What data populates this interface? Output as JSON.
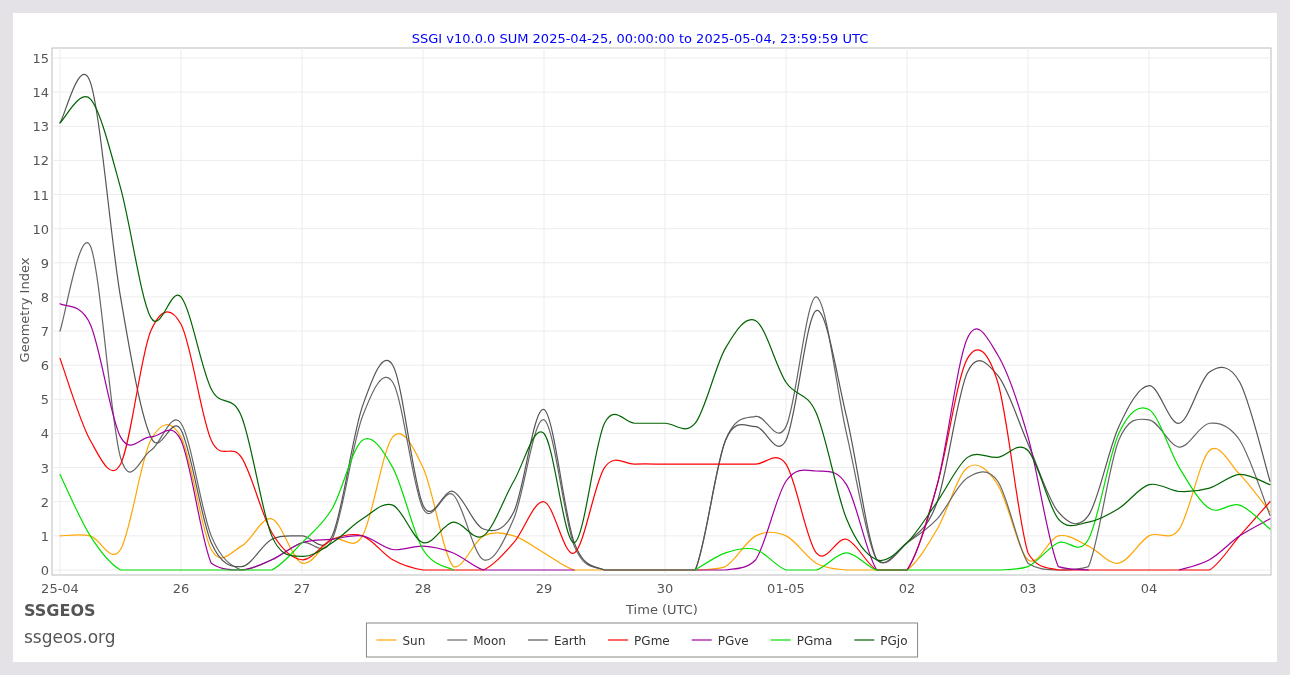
{
  "chart": {
    "brand": "SSGEOS",
    "site": "ssgeos.org",
    "chart_data": {
      "type": "line",
      "title": "SSGI v10.0.0 SUM 2025-04-25, 00:00:00 to 2025-05-04, 23:59:59 UTC",
      "xlabel": "Time (UTC)",
      "ylabel": "Geometry Index",
      "categories": [
        "25-04",
        null,
        null,
        null,
        "26",
        null,
        null,
        null,
        "27",
        null,
        null,
        null,
        "28",
        null,
        null,
        null,
        "29",
        null,
        null,
        null,
        "30",
        null,
        null,
        null,
        "01-05",
        null,
        null,
        null,
        "02",
        null,
        null,
        null,
        "03",
        null,
        null,
        null,
        "04",
        null,
        null,
        null,
        null
      ],
      "ylim": [
        0,
        15
      ],
      "grid": true,
      "legend": true,
      "yticks": [
        0,
        1,
        2,
        3,
        4,
        5,
        6,
        7,
        8,
        9,
        10,
        11,
        12,
        13,
        14,
        15
      ],
      "series": [
        {
          "name": "Sun",
          "color": "#ffa500",
          "values": [
            1,
            1,
            0.6,
            3.8,
            3.9,
            0.6,
            0.7,
            1.5,
            0.2,
            0.9,
            1,
            3.9,
            3,
            0.1,
            1,
            1,
            0.5,
            0,
            0,
            0,
            0,
            0,
            0.1,
            1,
            1,
            0.2,
            0,
            0,
            0,
            1.2,
            3,
            2.5,
            0.3,
            1,
            0.7,
            0.2,
            1,
            1.2,
            3.5,
            2.8,
            1.7
          ]
        },
        {
          "name": "Moon",
          "color": "#666666",
          "values": [
            7,
            9.5,
            3.3,
            3.5,
            4.3,
            1,
            0,
            0.3,
            0.8,
            0.9,
            4.5,
            5.5,
            1.8,
            2.2,
            0.3,
            1.5,
            4.4,
            0.7,
            0,
            0,
            0,
            0,
            3.8,
            4.5,
            4.2,
            8,
            4,
            0.3,
            0.8,
            1.5,
            2.7,
            2.6,
            0.2,
            0,
            0.1,
            3.8,
            4.4,
            3.6,
            4.3,
            3.8,
            1.6
          ]
        },
        {
          "name": "Earth",
          "color": "#555555",
          "values": [
            13.1,
            14.3,
            8,
            3.9,
            4.1,
            0.8,
            0.1,
            0.9,
            1,
            1,
            4.8,
            6,
            1.9,
            2.3,
            1.2,
            1.7,
            4.7,
            0.8,
            0,
            0,
            0,
            0,
            3.8,
            4.2,
            3.8,
            7.6,
            4.5,
            0.3,
            0.8,
            2,
            5.8,
            5.7,
            3.7,
            1.7,
            1.6,
            4.2,
            5.4,
            4.3,
            5.8,
            5.5,
            2.6
          ]
        },
        {
          "name": "PGme",
          "color": "#ff0000",
          "values": [
            6.2,
            3.8,
            3.1,
            7,
            7.2,
            3.8,
            3.3,
            1.1,
            0.3,
            0.9,
            1,
            0.3,
            0,
            0,
            0,
            0.8,
            2,
            0.5,
            3,
            3.1,
            3.1,
            3.1,
            3.1,
            3.1,
            3.1,
            0.5,
            0.9,
            0,
            0,
            2.5,
            6.2,
            5.5,
            0.5,
            0,
            0,
            0,
            0,
            0,
            0,
            1,
            2
          ]
        },
        {
          "name": "PGve",
          "color": "#a000a0",
          "values": [
            7.8,
            7.2,
            3.9,
            3.9,
            3.8,
            0.2,
            0,
            0.3,
            0.8,
            0.9,
            1,
            0.6,
            0.7,
            0.5,
            0,
            0,
            0,
            0,
            null,
            null,
            null,
            0,
            0,
            0.3,
            2.6,
            2.9,
            2.5,
            0,
            0,
            2.5,
            6.8,
            6.3,
            3.9,
            0.1,
            0,
            null,
            null,
            0,
            0.3,
            1,
            1.5
          ]
        },
        {
          "name": "PGma",
          "color": "#00e000",
          "values": [
            2.8,
            1,
            0,
            0,
            0,
            0,
            0,
            0,
            0.8,
            1.8,
            3.8,
            3,
            0.6,
            0,
            null,
            null,
            null,
            null,
            null,
            null,
            null,
            0,
            0.5,
            0.6,
            0,
            0,
            0.5,
            0,
            0,
            0,
            0,
            0,
            0.1,
            0.8,
            0.9,
            4,
            4.7,
            3,
            1.8,
            1.9,
            1.2
          ]
        },
        {
          "name": "PGjo",
          "color": "#006400",
          "values": [
            13.1,
            13.8,
            11.2,
            7.4,
            8,
            5.3,
            4.5,
            1,
            0.4,
            0.8,
            1.5,
            1.9,
            0.8,
            1.4,
            1,
            2.6,
            4,
            0.8,
            4.3,
            4.3,
            4.3,
            4.3,
            6.5,
            7.3,
            5.5,
            4.6,
            1.5,
            0.3,
            0.8,
            2,
            3.3,
            3.3,
            3.5,
            1.5,
            1.4,
            1.8,
            2.5,
            2.3,
            2.4,
            2.8,
            2.5
          ]
        }
      ]
    }
  }
}
